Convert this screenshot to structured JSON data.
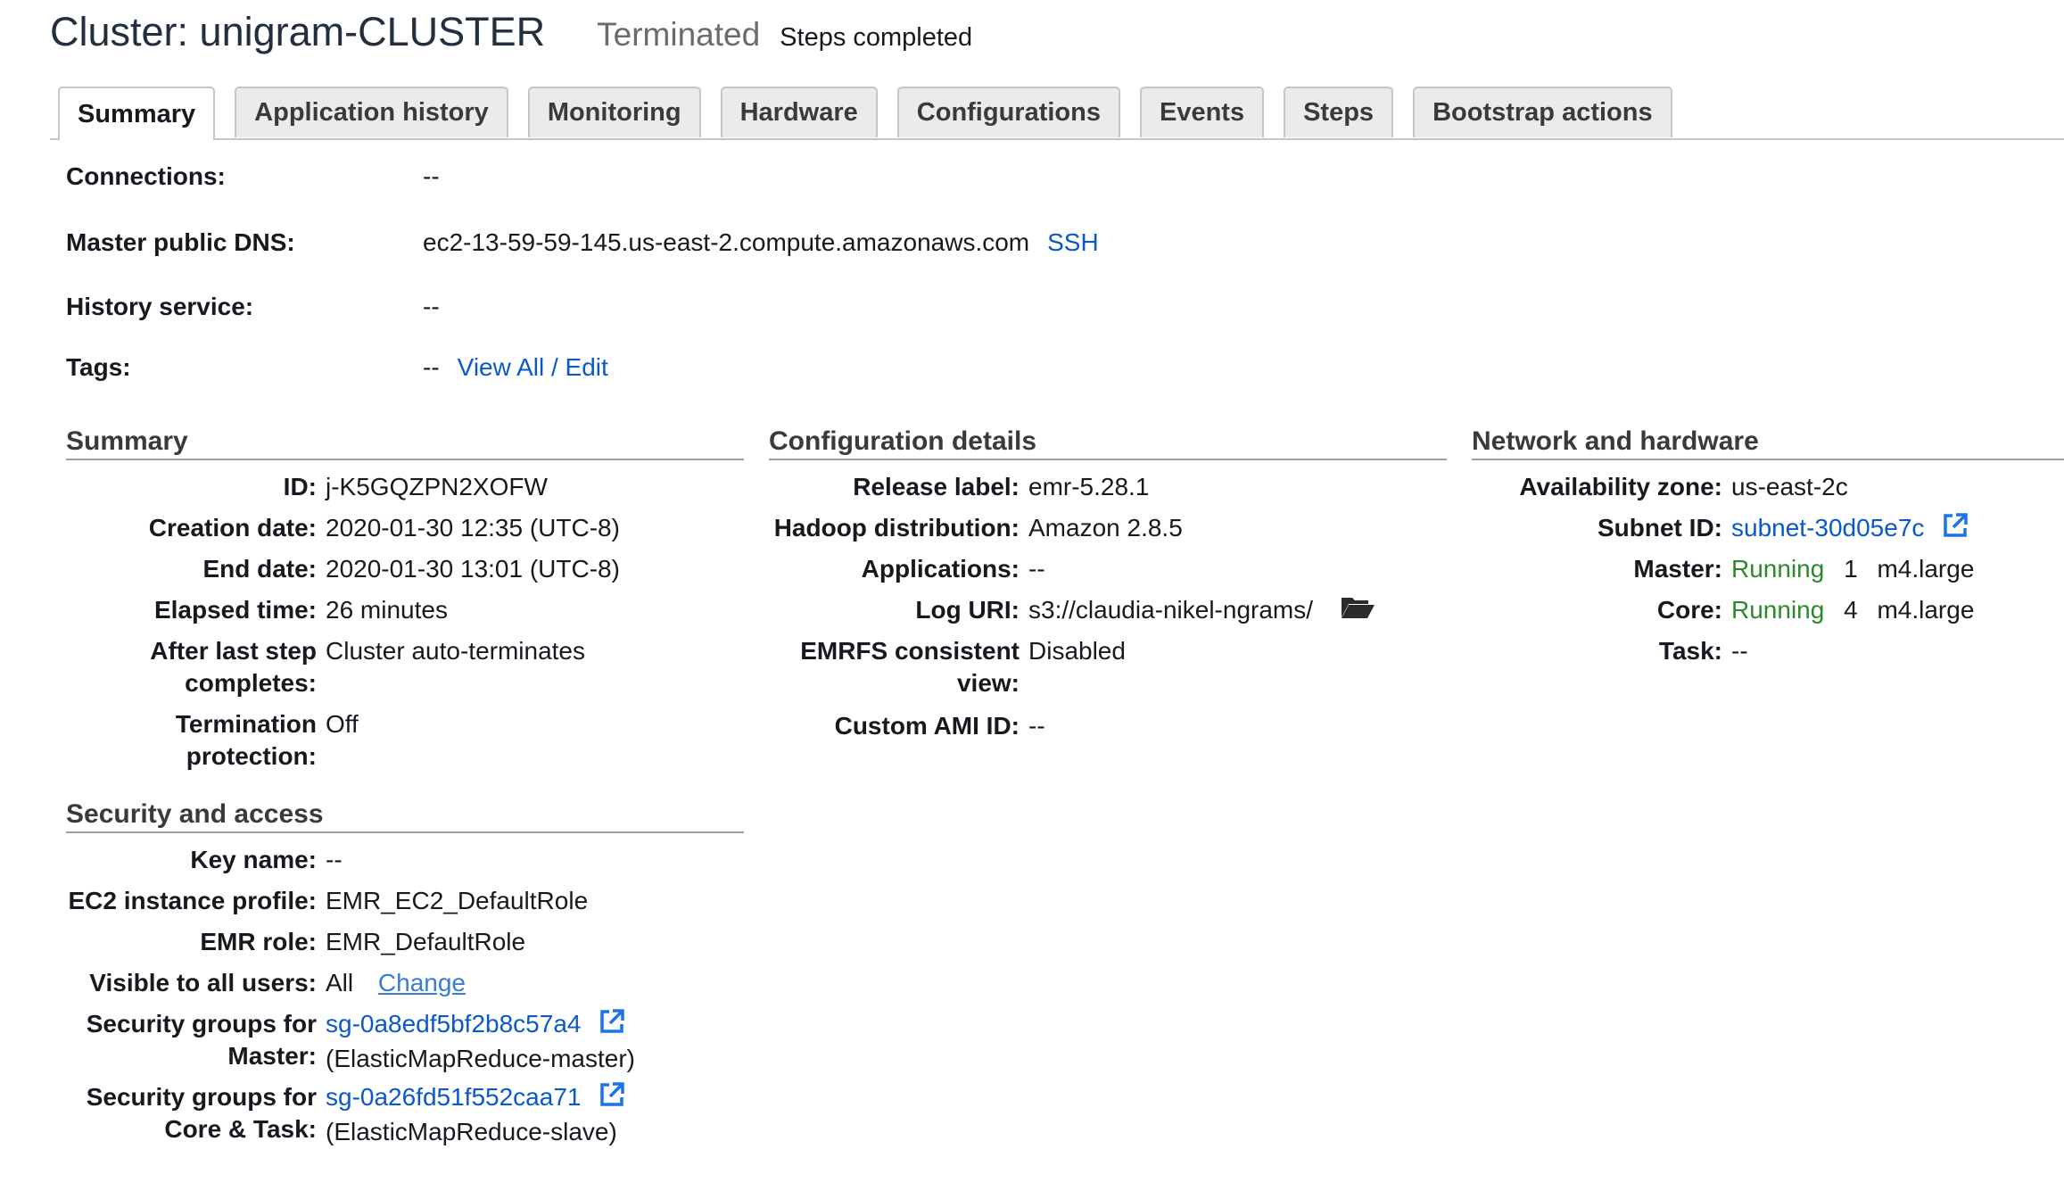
{
  "header": {
    "title": "Cluster: unigram-CLUSTER",
    "status": "Terminated",
    "status_detail": "Steps completed"
  },
  "tabs": [
    {
      "label": "Summary",
      "active": true
    },
    {
      "label": "Application history"
    },
    {
      "label": "Monitoring"
    },
    {
      "label": "Hardware"
    },
    {
      "label": "Configurations"
    },
    {
      "label": "Events"
    },
    {
      "label": "Steps"
    },
    {
      "label": "Bootstrap actions"
    }
  ],
  "top": {
    "connections_label": "Connections:",
    "connections_value": "--",
    "dns_label": "Master public DNS:",
    "dns_value": "ec2-13-59-59-145.us-east-2.compute.amazonaws.com",
    "ssh_link": "SSH",
    "history_label": "History service:",
    "history_value": "--",
    "tags_label": "Tags:",
    "tags_value": "--",
    "tags_link": "View All / Edit"
  },
  "summary": {
    "title": "Summary",
    "id_label": "ID:",
    "id_value": "j-K5GQZPN2XOFW",
    "creation_label": "Creation date:",
    "creation_value": "2020-01-30 12:35 (UTC-8)",
    "end_label": "End date:",
    "end_value": "2020-01-30 13:01 (UTC-8)",
    "elapsed_label": "Elapsed time:",
    "elapsed_value": "26 minutes",
    "after_label_1": "After last step",
    "after_label_2": "completes:",
    "after_value": "Cluster auto-terminates",
    "term_label_1": "Termination",
    "term_label_2": "protection:",
    "term_value": "Off"
  },
  "config": {
    "title": "Configuration details",
    "release_label": "Release label:",
    "release_value": "emr-5.28.1",
    "hadoop_label": "Hadoop distribution:",
    "hadoop_value": "Amazon 2.8.5",
    "apps_label": "Applications:",
    "apps_value": "--",
    "log_label": "Log URI:",
    "log_value": "s3://claudia-nikel-ngrams/",
    "emrfs_label_1": "EMRFS consistent",
    "emrfs_label_2": "view:",
    "emrfs_value": "Disabled",
    "ami_label": "Custom AMI ID:",
    "ami_value": "--"
  },
  "network": {
    "title": "Network and hardware",
    "az_label": "Availability zone:",
    "az_value": "us-east-2c",
    "subnet_label": "Subnet ID:",
    "subnet_value": "subnet-30d05e7c",
    "master_label": "Master:",
    "master_status": "Running",
    "master_count": "1",
    "master_type": "m4.large",
    "core_label": "Core:",
    "core_status": "Running",
    "core_count": "4",
    "core_type": "m4.large",
    "task_label": "Task:",
    "task_value": "--"
  },
  "security": {
    "title": "Security and access",
    "key_label": "Key name:",
    "key_value": "--",
    "ec2_label": "EC2 instance profile:",
    "ec2_value": "EMR_EC2_DefaultRole",
    "role_label": "EMR role:",
    "role_value": "EMR_DefaultRole",
    "visible_label": "Visible to all users:",
    "visible_value": "All",
    "visible_link": "Change",
    "sg_master_label_1": "Security groups for",
    "sg_master_label_2": "Master:",
    "sg_master_link": "sg-0a8edf5bf2b8c57a4",
    "sg_master_name": "(ElasticMapReduce-master)",
    "sg_core_label_1": "Security groups for",
    "sg_core_label_2": "Core & Task:",
    "sg_core_link": "sg-0a26fd51f552caa71",
    "sg_core_name": "(ElasticMapReduce-slave)"
  },
  "colors": {
    "link": "#0a58ca",
    "running": "#2a8a2a",
    "status_grey": "#6b6b6b"
  }
}
